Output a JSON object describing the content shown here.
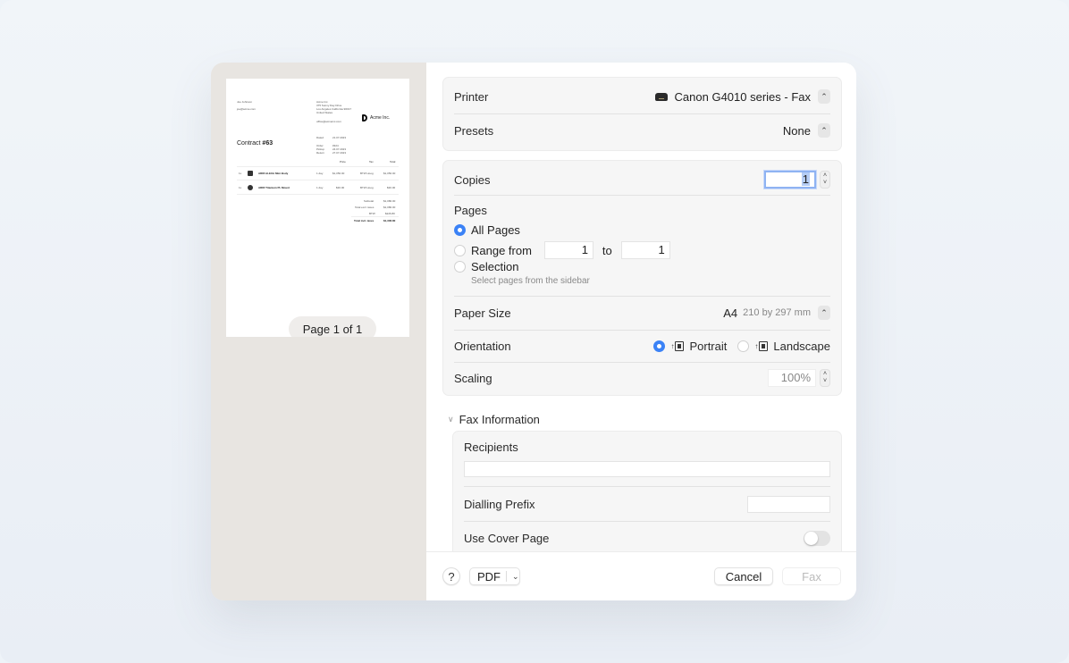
{
  "preview": {
    "document": {
      "customer_name": "Joe Johnson",
      "customer_email": "joe@acme.com",
      "company_name": "Acme Inc.",
      "company_address": [
        "375 Sunny Day Drive",
        "Los Angeles California 90017",
        "United States"
      ],
      "company_email": "office@acmeinc.com",
      "logo_text": "Acme Inc.",
      "title_prefix": "Contract",
      "title_number": "#63",
      "meta": [
        {
          "label": "Dated",
          "value": "21.07.2023"
        },
        {
          "label": "Order",
          "value": "#324"
        },
        {
          "label": "Pickup",
          "value": "24.07.2023"
        },
        {
          "label": "Return",
          "value": "27.07.2023"
        }
      ],
      "columns": [
        "Price",
        "Tax",
        "Total"
      ],
      "items": [
        {
          "qty": "1x",
          "name": "ARRI ALEXA Mini Body",
          "duration": "1 day",
          "price": "$1,050.00",
          "tax": "BTW Hoog",
          "total": "$1,050.00"
        },
        {
          "qty": "1x",
          "name": "ARRI Titanium PL Mount",
          "duration": "1 day",
          "price": "$30.00",
          "tax": "BTW Hoog",
          "total": "$30.00"
        }
      ],
      "totals": [
        {
          "label": "Subtotal",
          "value": "$1,080.00"
        },
        {
          "label": "Total excl. taxes",
          "value": "$1,080.00"
        },
        {
          "label": "BTW",
          "value": "$226.80"
        },
        {
          "label": "Total incl. taxes",
          "value": "$1,306.80"
        }
      ]
    },
    "page_indicator": "Page 1 of 1"
  },
  "settings": {
    "printer": {
      "label": "Printer",
      "value": "Canon G4010 series - Fax",
      "icon": "printer-icon"
    },
    "presets": {
      "label": "Presets",
      "value": "None"
    },
    "copies": {
      "label": "Copies",
      "value": "1"
    },
    "pages": {
      "label": "Pages",
      "options": [
        {
          "label": "All Pages",
          "selected": true
        },
        {
          "label": "Range from",
          "selected": false
        },
        {
          "label": "Selection",
          "selected": false
        }
      ],
      "range_from": "1",
      "range_to_label": "to",
      "range_to": "1",
      "selection_hint": "Select pages from the sidebar"
    },
    "paper_size": {
      "label": "Paper Size",
      "value": "A4",
      "detail": "210 by 297 mm"
    },
    "orientation": {
      "label": "Orientation",
      "options": [
        {
          "label": "Portrait",
          "selected": true
        },
        {
          "label": "Landscape",
          "selected": false
        }
      ]
    },
    "scaling": {
      "label": "Scaling",
      "value": "100%"
    }
  },
  "fax_information": {
    "section_label": "Fax Information",
    "expanded": true,
    "recipients": {
      "label": "Recipients",
      "value": ""
    },
    "dialling_prefix": {
      "label": "Dialling Prefix",
      "value": ""
    },
    "use_cover_page": {
      "label": "Use Cover Page",
      "enabled": false
    }
  },
  "footer": {
    "help_label": "?",
    "pdf_label": "PDF",
    "cancel_label": "Cancel",
    "fax_label": "Fax",
    "fax_enabled": false
  },
  "colors": {
    "accent": "#3b82f6",
    "sidebar_bg": "#e8e5e1",
    "panel_bg": "#f6f6f6"
  }
}
